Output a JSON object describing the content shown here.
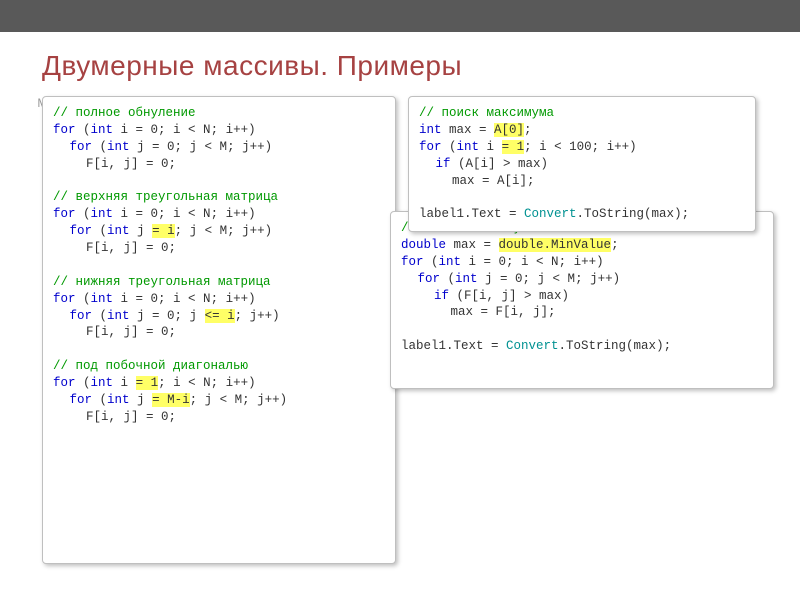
{
  "title": "Двумерные массивы. Примеры",
  "brand": {
    "top": "MySh",
    "bot": "..."
  },
  "box_left": {
    "l1": "// полное обнуление",
    "l2a": "for",
    "l2b": " (",
    "l2c": "int",
    "l2d": " i = 0; i < N; i++)",
    "l3a": "for",
    "l3b": " (",
    "l3c": "int",
    "l3d": " j = 0; j < M; j++)",
    "l4": "F[i, j] = 0;",
    "l5": "// верхняя треугольная матрица",
    "l6a": "for",
    "l6b": " (",
    "l6c": "int",
    "l6d": " i = 0; i < N; i++)",
    "l7a": "for",
    "l7b": " (",
    "l7c": "int",
    "l7d": " j ",
    "l7e": "= i",
    "l7f": "; j < M; j++)",
    "l8": "F[i, j] = 0;",
    "l9": "// нижняя треугольная матрица",
    "l10a": "for",
    "l10b": " (",
    "l10c": "int",
    "l10d": " i = 0; i < N; i++)",
    "l11a": "for",
    "l11b": " (",
    "l11c": "int",
    "l11d": " j = 0; j ",
    "l11e": "<= i",
    "l11f": "; j++)",
    "l12": "F[i, j] = 0;",
    "l13": "// под побочной диагональю",
    "l14a": "for",
    "l14b": " (",
    "l14c": "int",
    "l14d": " i ",
    "l14e": "= 1",
    "l14f": "; i < N; i++)",
    "l15a": "for",
    "l15b": " (",
    "l15c": "int",
    "l15d": " j ",
    "l15e": "= M-i",
    "l15f": "; j < M; j++)",
    "l16": "F[i, j] = 0;"
  },
  "box_r1": {
    "l1": "// поиск максимума",
    "l2a": "int",
    "l2b": " max = ",
    "l2c": "A[0]",
    "l2d": ";",
    "l3a": "for",
    "l3b": " (",
    "l3c": "int",
    "l3d": " i ",
    "l3e": "= 1",
    "l3f": "; i < 100; i++)",
    "l4a": "if",
    "l4b": " (A[i] > max)",
    "l5": "max = A[i];",
    "l6a": "label1.Text = ",
    "l6b": "Convert",
    "l6c": ".ToString(max);"
  },
  "box_r2": {
    "l1": "// поиск максимума",
    "l2a": "double",
    "l2b": " max = ",
    "l2c": "double.MinValue",
    "l2d": ";",
    "l3a": "for",
    "l3b": " (",
    "l3c": "int",
    "l3d": " i = 0; i < N; i++)",
    "l4a": "for",
    "l4b": " (",
    "l4c": "int",
    "l4d": " j = 0; j < M; j++)",
    "l5a": "if",
    "l5b": " (F[i, j] > max)",
    "l6": "max = F[i, j];",
    "l7a": "label1.Text = ",
    "l7b": "Convert",
    "l7c": ".ToString(max);"
  }
}
